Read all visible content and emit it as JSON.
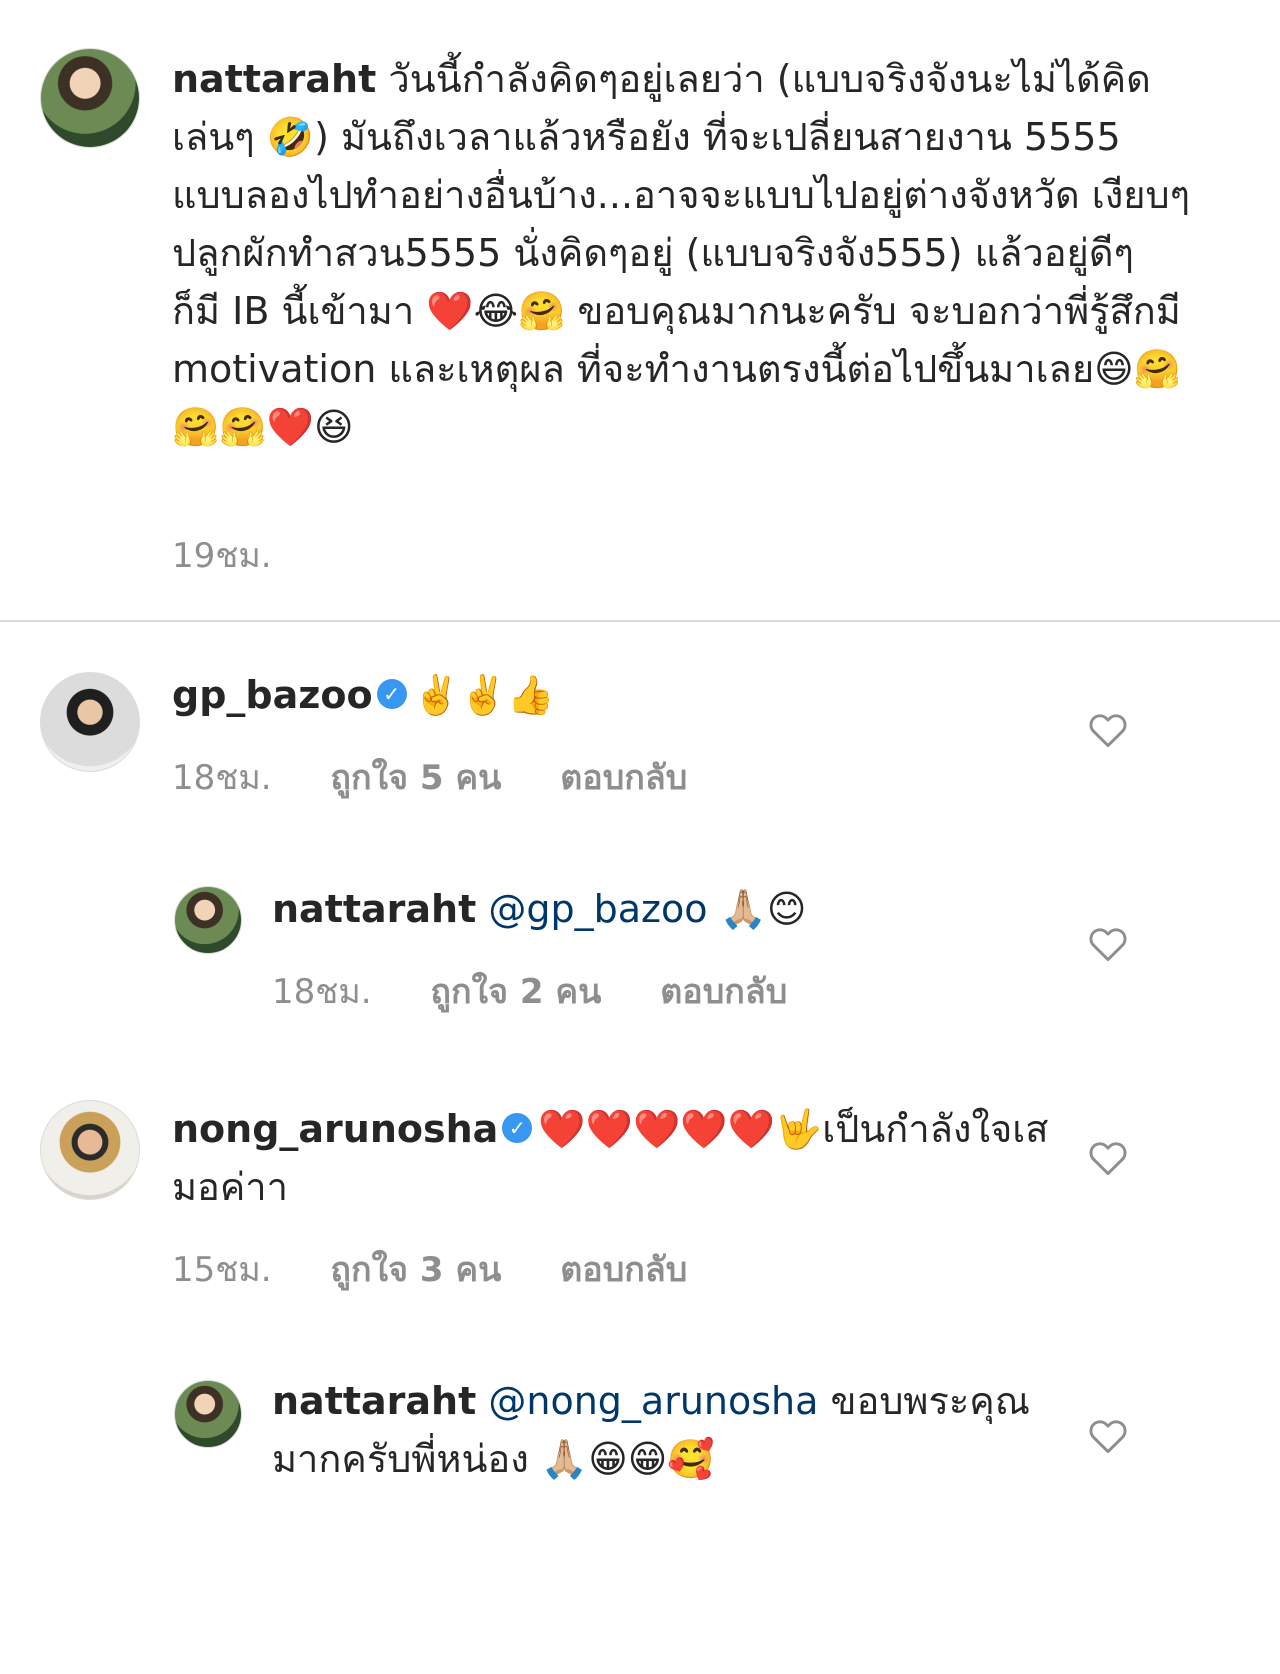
{
  "caption": {
    "username": "nattaraht",
    "text_1": "วันนี้กำลังคิดๆอยู่เลยว่า (แบบจริงจังนะไม่ได้คิดเล่นๆ ",
    "emoji_1": "🤣",
    "text_2": ") มันถึงเวลาแล้วหรือยัง ที่จะเปลี่ยนสายงาน 5555 แบบลองไปทำอย่างอื่นบ้าง...อาจจะแบบไปอยู่ต่างจังหวัด เงียบๆ ปลูกผักทำสวน5555 นั่งคิดๆอยู่ (แบบจริงจัง555) แล้วอยู่ดีๆ ก็มี IB นี้เข้ามา ",
    "emoji_2": "❤️😂🤗",
    "text_3": " ขอบคุณมากนะครับ จะบอกว่าพี่รู้สึกมี motivation และเหตุผล ที่จะทำงานตรงนี้ต่อไปขึ้นมาเลย",
    "emoji_3": "😄🤗🤗🤗❤️😆",
    "time": "19ชม."
  },
  "comments": [
    {
      "username": "gp_bazoo",
      "verified": true,
      "text": "✌️✌️👍",
      "time": "18ชม.",
      "likes": "ถูกใจ 5 คน",
      "reply": "ตอบกลับ"
    },
    {
      "username": "nattaraht",
      "mention": "@gp_bazoo",
      "text": " 🙏🏼😊",
      "time": "18ชม.",
      "likes": "ถูกใจ 2 คน",
      "reply": "ตอบกลับ"
    },
    {
      "username": "nong_arunosha",
      "verified": true,
      "emoji": "❤️❤️❤️❤️❤️🤟",
      "text": "เป็นกำลังใจเสมอค่าา",
      "time": "15ชม.",
      "likes": "ถูกใจ 3 คน",
      "reply": "ตอบกลับ"
    },
    {
      "username": "nattaraht",
      "mention": "@nong_arunosha",
      "text": "ขอบพระคุณมากครับพี่หน่อง 🙏🏼😁😁🥰"
    }
  ],
  "colors": {
    "text": "#262626",
    "meta": "#8e8e8e",
    "mention": "#00376b",
    "verified": "#3897f0",
    "divider": "#dbdbdb"
  },
  "icons": {
    "verified": "verified-badge-icon",
    "like": "heart-outline-icon"
  }
}
